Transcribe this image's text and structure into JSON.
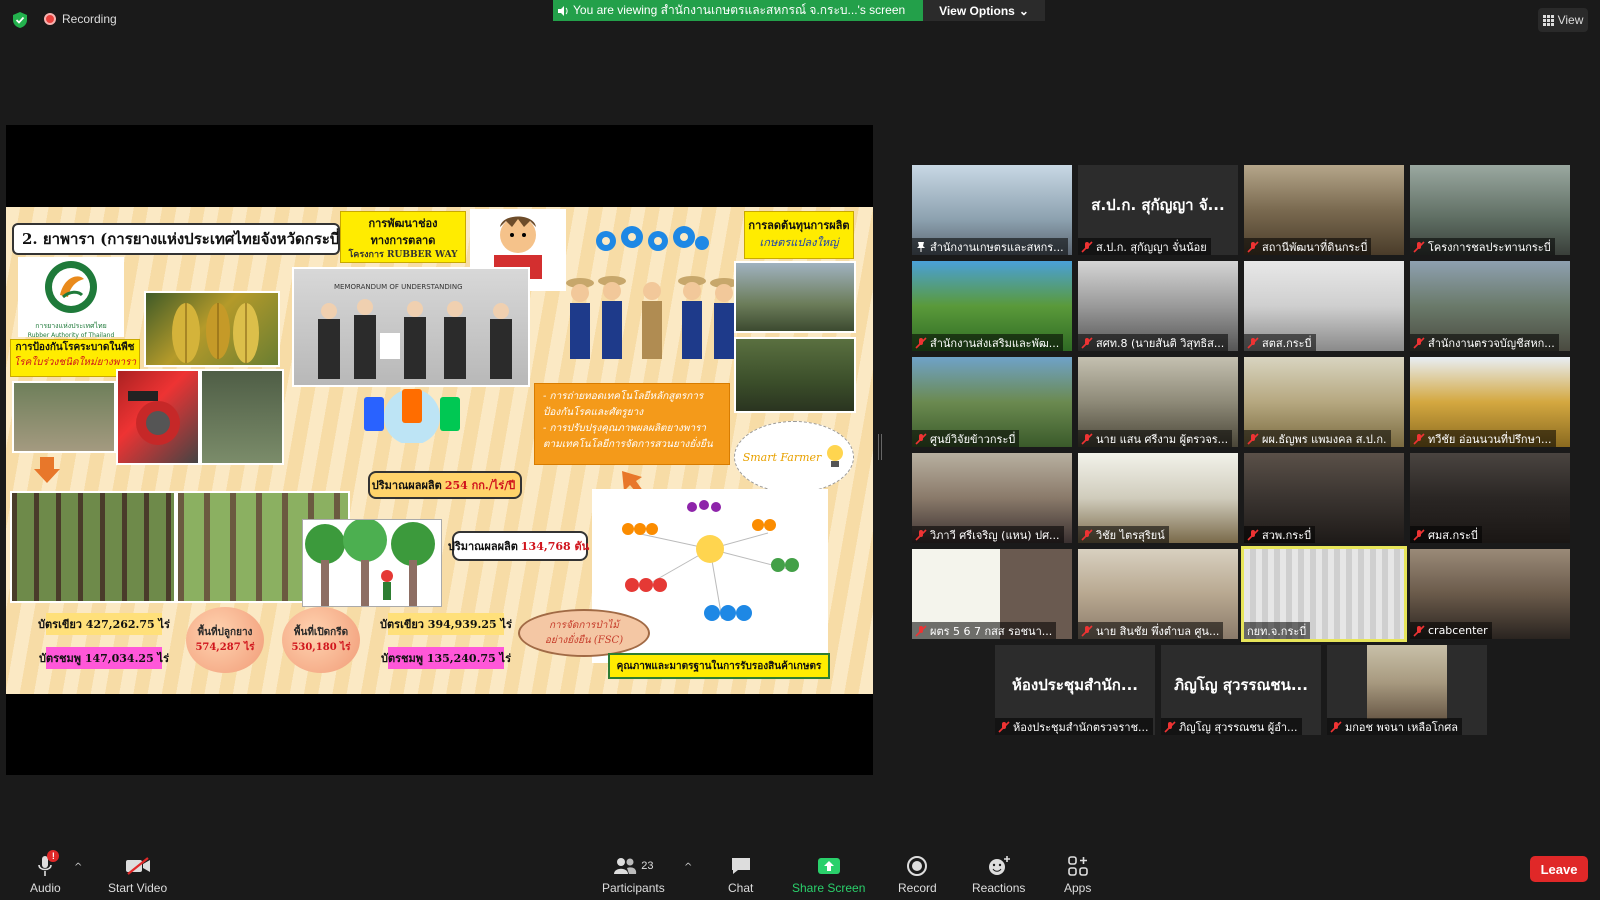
{
  "topbar": {
    "recording_label": "Recording",
    "banner_text": "You are viewing สำนักงานเกษตรและสหกรณ์ จ.กระบ...'s screen",
    "view_options_label": "View Options",
    "view_label": "View"
  },
  "slide": {
    "title": "2. ยาพารา (การยางแห่งประเทศไทยจังหวัดกระบี่",
    "marketing_box": "การพัฒนาช่องทางการตลาด",
    "marketing_sub": "โครงการ RUBBER WAY",
    "cost_box_line1": "การลดต้นทุนการผลิต",
    "cost_box_line2": "เกษตรแปลงใหญ่",
    "rat_logo_text": "การยางแห่งประเทศไทย",
    "rat_logo_sub": "Rubber Authority of Thailand",
    "disease_box_line1": "การป้องกันโรคระบาดในพืช",
    "disease_box_line2": "โรคใบร่วงชนิดใหม่ยางพารา",
    "mou_text": "MEMORANDUM OF UNDERSTANDING",
    "tech_line1": "- การถ่ายทอดเทคโนโลยีหลักสูตรการ",
    "tech_line2": "ป้องกันโรคและศัตรูยาง",
    "tech_line3": "- การปรับปรุงคุณภาพผลผลิตยางพารา",
    "tech_line4": "ตามเทคโนโลยีการจัดการสวนยางยั่งยืน",
    "smart_farmer": "Smart Farmer",
    "yield_label": "ปริมาณผลผลิต",
    "yield_value": "254 กก./ไร่/ปี",
    "total_label": "ปริมาณผลผลิต",
    "total_value": "134,768 ตัน",
    "green_card": "บัตรเขียว 427,262.75 ไร่",
    "pink_card": "บัตรชมพู 147,034.25 ไร่",
    "plant_area_label": "พื้นที่ปลูกยาง",
    "plant_area_value": "574,287 ไร่",
    "tap_area_label": "พื้นที่เปิดกรีด",
    "tap_area_value": "530,180 ไร่",
    "green_card2": "บัตรเขียว 394,939.25 ไร่",
    "pink_card2": "บัตรชมพู 135,240.75 ไร่",
    "fsc_line1": "การจัดการป่าไม้",
    "fsc_line2": "อย่างยั่งยืน (FSC)",
    "quality_box": "คุณภาพและมาตรฐานในการรับรองสินค้าเกษตร"
  },
  "participants": [
    {
      "label": "สำนักงานเกษตรและสหกร...",
      "bigname": ""
    },
    {
      "label": "ส.ป.ก. สุกัญญา จั่นน้อย",
      "bigname": "ส.ป.ก. สุกัญญา จั..."
    },
    {
      "label": "สถานีพัฒนาที่ดินกระบี่",
      "bigname": ""
    },
    {
      "label": "โครงการชลประทานกระบี่",
      "bigname": ""
    },
    {
      "label": "สำนักงานส่งเสริมและพัฒ...",
      "bigname": ""
    },
    {
      "label": "สศท.8 (นายสันติ วิสุทธิส...",
      "bigname": ""
    },
    {
      "label": "สตส.กระบี่",
      "bigname": ""
    },
    {
      "label": "สำนักงานตรวจบัญชีสหก...",
      "bigname": ""
    },
    {
      "label": "ศูนย์วิจัยข้าวกระบี่",
      "bigname": ""
    },
    {
      "label": "นาย แสน ศรีงาม ผู้ตรวจร...",
      "bigname": ""
    },
    {
      "label": "ผผ.ธัญพร แพมงคล ส.ป.ก.",
      "bigname": ""
    },
    {
      "label": "ทวีชัย อ่อนนวนที่ปรึกษา...",
      "bigname": ""
    },
    {
      "label": "วิภาวี ศรีเจริญ (แหน) ปศ...",
      "bigname": ""
    },
    {
      "label": "วิชัย ไตรสุริยน์",
      "bigname": ""
    },
    {
      "label": "สวพ.กระบี่",
      "bigname": ""
    },
    {
      "label": "ศมส.กระบี่",
      "bigname": ""
    },
    {
      "label": "ผตร 5 6 7 กสส รอชนา...",
      "bigname": ""
    },
    {
      "label": "นาย สินชัย พึ่งตำบล ศูน...",
      "bigname": ""
    },
    {
      "label": "กยท.จ.กระบี่",
      "bigname": ""
    },
    {
      "label": "crabcenter",
      "bigname": ""
    },
    {
      "label": "ห้องประชุมสำนักตรวจราช...",
      "bigname": "ห้องประชุมสำนัก..."
    },
    {
      "label": "ภิญโญ สุวรรณชน ผู้อำ...",
      "bigname": "ภิญโญ สุวรรณชน..."
    },
    {
      "label": "มกอช พจนา เหลือโกศล",
      "bigname": ""
    }
  ],
  "toolbar": {
    "audio": "Audio",
    "start_video": "Start Video",
    "participants": "Participants",
    "participants_count": "23",
    "chat": "Chat",
    "share_screen": "Share Screen",
    "record": "Record",
    "reactions": "Reactions",
    "apps": "Apps",
    "leave": "Leave",
    "audio_badge": "!"
  },
  "colors": {
    "banner_green": "#23a04a",
    "leave_red": "#e02828",
    "active_speaker": "#e7e55a",
    "share_green": "#2ad06b"
  }
}
